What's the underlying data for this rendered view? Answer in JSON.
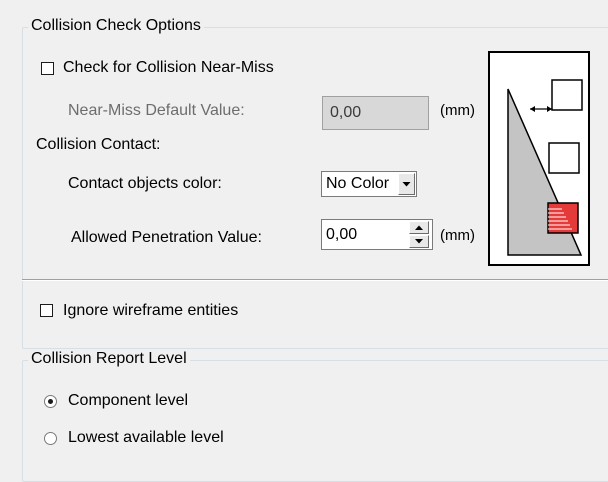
{
  "collision_check": {
    "title": "Collision Check Options",
    "near_miss_checkbox_label": "Check for Collision Near-Miss",
    "near_miss_checked": false,
    "near_miss_default_label": "Near-Miss Default Value:",
    "near_miss_default_value": "0,00",
    "near_miss_unit": "(mm)",
    "collision_contact_label": "Collision Contact:",
    "contact_color_label": "Contact objects color:",
    "contact_color_selected": "No Color",
    "penetration_label": "Allowed Penetration Value:",
    "penetration_value": "0,00",
    "penetration_unit": "(mm)",
    "ignore_wireframe_label": "Ignore wireframe entities",
    "ignore_wireframe_checked": false
  },
  "report_level": {
    "title": "Collision Report Level",
    "options": [
      {
        "label": "Component level",
        "checked": true
      },
      {
        "label": "Lowest available level",
        "checked": false
      }
    ]
  },
  "diagram": {
    "fill_color": "#c4c4c4",
    "penetration_color": "#e53a3a",
    "icons": [
      "arrow-left-right-icon",
      "hatch-icon"
    ]
  }
}
